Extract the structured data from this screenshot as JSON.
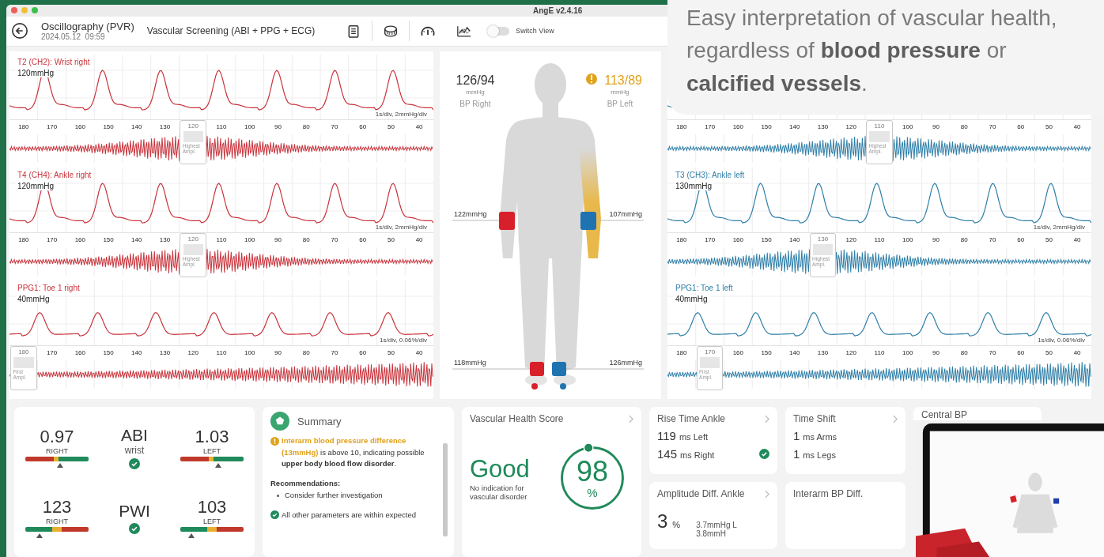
{
  "window": {
    "title": "AngE v2.4.16"
  },
  "toolbar": {
    "title": "Oscillography (PVR)",
    "date": "2024.05.12  09:59",
    "exam": "Vascular Screening (ABI + PPG + ECG)",
    "switch_view": {
      "label": "Switch View",
      "on": false
    }
  },
  "callout": {
    "text": "Easy interpretation of vascular health, regardless of **blood pressure** or **calcified vessels**."
  },
  "channels_right": [
    {
      "name": "T2 (CH2): Wrist right",
      "color": "#c8343c",
      "pressure": "120mmHg",
      "scale": "1s/div, 2mmHg/div",
      "kind": "pressure",
      "marker_label": "Highest Ampl.",
      "ticks": [
        {
          "label": "180",
          "marked": false
        },
        {
          "label": "170",
          "marked": false
        },
        {
          "label": "160",
          "marked": false
        },
        {
          "label": "150",
          "marked": false
        },
        {
          "label": "140",
          "marked": false
        },
        {
          "label": "130",
          "marked": false
        },
        {
          "label": "120",
          "marked": true
        },
        {
          "label": "110",
          "marked": false
        },
        {
          "label": "100",
          "marked": false
        },
        {
          "label": "90",
          "marked": false
        },
        {
          "label": "80",
          "marked": false
        },
        {
          "label": "70",
          "marked": false
        },
        {
          "label": "60",
          "marked": false
        },
        {
          "label": "50",
          "marked": false
        },
        {
          "label": "40",
          "marked": false
        }
      ]
    },
    {
      "name": "T4 (CH4): Ankle right",
      "color": "#c8343c",
      "pressure": "120mmHg",
      "scale": "1s/div, 2mmHg/div",
      "kind": "pressure",
      "marker_label": "Highest Ampl.",
      "ticks": [
        {
          "label": "180",
          "marked": false
        },
        {
          "label": "170",
          "marked": false
        },
        {
          "label": "160",
          "marked": false
        },
        {
          "label": "150",
          "marked": false
        },
        {
          "label": "140",
          "marked": false
        },
        {
          "label": "130",
          "marked": false
        },
        {
          "label": "120",
          "marked": true
        },
        {
          "label": "110",
          "marked": false
        },
        {
          "label": "100",
          "marked": false
        },
        {
          "label": "90",
          "marked": false
        },
        {
          "label": "80",
          "marked": false
        },
        {
          "label": "70",
          "marked": false
        },
        {
          "label": "60",
          "marked": false
        },
        {
          "label": "50",
          "marked": false
        },
        {
          "label": "40",
          "marked": false
        }
      ]
    },
    {
      "name": "PPG1: Toe 1 right",
      "color": "#c8343c",
      "pressure": "40mmHg",
      "scale": "1s/div, 0.06%/div",
      "kind": "ppg",
      "marker_label": "First Ampl.",
      "ticks": [
        {
          "label": "180",
          "marked": true
        },
        {
          "label": "170",
          "marked": false
        },
        {
          "label": "160",
          "marked": false
        },
        {
          "label": "150",
          "marked": false
        },
        {
          "label": "140",
          "marked": false
        },
        {
          "label": "130",
          "marked": false
        },
        {
          "label": "120",
          "marked": false
        },
        {
          "label": "110",
          "marked": false
        },
        {
          "label": "100",
          "marked": false
        },
        {
          "label": "90",
          "marked": false
        },
        {
          "label": "80",
          "marked": false
        },
        {
          "label": "70",
          "marked": false
        },
        {
          "label": "60",
          "marked": false
        },
        {
          "label": "50",
          "marked": false
        },
        {
          "label": "40",
          "marked": false
        }
      ]
    }
  ],
  "body": {
    "bp_right": {
      "value": "126/94",
      "unit": "mmHg",
      "label": "BP Right",
      "warning": false
    },
    "bp_left": {
      "value": "113/89",
      "unit": "mmHg",
      "label": "BP Left",
      "warning": true
    },
    "arm_right": "122mmHg",
    "arm_left": "107mmHg",
    "ankle_right": "118mmHg",
    "ankle_left": "126mmHg"
  },
  "channels_left": [
    {
      "color": "#2f7fa8",
      "kind": "pressure",
      "marker_label": "Highest Ampl.",
      "ticks": [
        {
          "label": "180",
          "marked": false
        },
        {
          "label": "170",
          "marked": false
        },
        {
          "label": "160",
          "marked": false
        },
        {
          "label": "150",
          "marked": false
        },
        {
          "label": "140",
          "marked": false
        },
        {
          "label": "130",
          "marked": false
        },
        {
          "label": "120",
          "marked": false
        },
        {
          "label": "110",
          "marked": true
        },
        {
          "label": "100",
          "marked": false
        },
        {
          "label": "90",
          "marked": false
        },
        {
          "label": "80",
          "marked": false
        },
        {
          "label": "70",
          "marked": false
        },
        {
          "label": "60",
          "marked": false
        },
        {
          "label": "50",
          "marked": false
        },
        {
          "label": "40",
          "marked": false
        }
      ]
    },
    {
      "name": "T3 (CH3): Ankle left",
      "color": "#2f7fa8",
      "pressure": "130mmHg",
      "scale": "1s/div, 2mmHg/div",
      "kind": "pressure",
      "marker_label": "Highest Ampl.",
      "ticks": [
        {
          "label": "180",
          "marked": false
        },
        {
          "label": "170",
          "marked": false
        },
        {
          "label": "160",
          "marked": false
        },
        {
          "label": "150",
          "marked": false
        },
        {
          "label": "140",
          "marked": false
        },
        {
          "label": "130",
          "marked": true
        },
        {
          "label": "120",
          "marked": false
        },
        {
          "label": "110",
          "marked": false
        },
        {
          "label": "100",
          "marked": false
        },
        {
          "label": "90",
          "marked": false
        },
        {
          "label": "80",
          "marked": false
        },
        {
          "label": "70",
          "marked": false
        },
        {
          "label": "60",
          "marked": false
        },
        {
          "label": "50",
          "marked": false
        },
        {
          "label": "40",
          "marked": false
        }
      ]
    },
    {
      "name": "PPG1: Toe 1 left",
      "color": "#2f7fa8",
      "pressure": "40mmHg",
      "scale": "1s/div, 0.06%/div",
      "kind": "ppg",
      "marker_label": "First Ampl.",
      "ticks": [
        {
          "label": "180",
          "marked": false
        },
        {
          "label": "170",
          "marked": true
        },
        {
          "label": "160",
          "marked": false
        },
        {
          "label": "150",
          "marked": false
        },
        {
          "label": "140",
          "marked": false
        },
        {
          "label": "130",
          "marked": false
        },
        {
          "label": "120",
          "marked": false
        },
        {
          "label": "110",
          "marked": false
        },
        {
          "label": "100",
          "marked": false
        },
        {
          "label": "90",
          "marked": false
        },
        {
          "label": "80",
          "marked": false
        },
        {
          "label": "70",
          "marked": false
        },
        {
          "label": "60",
          "marked": false
        },
        {
          "label": "50",
          "marked": false
        },
        {
          "label": "40",
          "marked": false
        }
      ]
    }
  ],
  "indices": [
    {
      "kind": "abi",
      "name": "ABI",
      "sub": "wrist",
      "ok": true,
      "right": {
        "value": "0.97",
        "label": "RIGHT",
        "level": 0.55
      },
      "left": {
        "value": "1.03",
        "label": "LEFT",
        "level": 0.6
      }
    },
    {
      "kind": "pwi",
      "name": "PWI",
      "ok": true,
      "right": {
        "value": "123",
        "label": "RIGHT",
        "level": 0.23
      },
      "left": {
        "value": "103",
        "label": "LEFT",
        "level": 0.18
      }
    }
  ],
  "summary": {
    "title": "Summary",
    "warning_text": "**Interarm blood pressure difference (13mmHg)** is above 10, indicating possible **upper body blood flow disorder**.",
    "recommendations_title": "Recommendations:",
    "recommendations": [
      "Consider further investigation"
    ],
    "ok_text": "All other parameters are within expected"
  },
  "score": {
    "title": "Vascular Health Score",
    "rating": "Good",
    "note": "No indication for vascular disorder",
    "value": "98",
    "unit": "%",
    "level": 0.98
  },
  "metrics": [
    {
      "title": "Rise Time Ankle",
      "chevron": true,
      "ok": true,
      "rows": [
        {
          "value": "119",
          "unit": "ms Left"
        },
        {
          "value": "145",
          "unit": "ms Right"
        }
      ]
    },
    {
      "title": "Time Shift",
      "chevron": true,
      "rows": [
        {
          "value": "1",
          "unit": "ms Arms"
        },
        {
          "value": "1",
          "unit": "ms Legs"
        }
      ]
    },
    {
      "title": "Central BP",
      "chevron": false
    },
    {
      "title": "Amplitude Diff. Ankle",
      "chevron": true,
      "big": "3",
      "big_unit": "%",
      "lines": [
        "3.7mmHg L",
        "3.8mmH"
      ]
    },
    {
      "title": "Interarm BP Diff.",
      "chevron": false
    }
  ]
}
